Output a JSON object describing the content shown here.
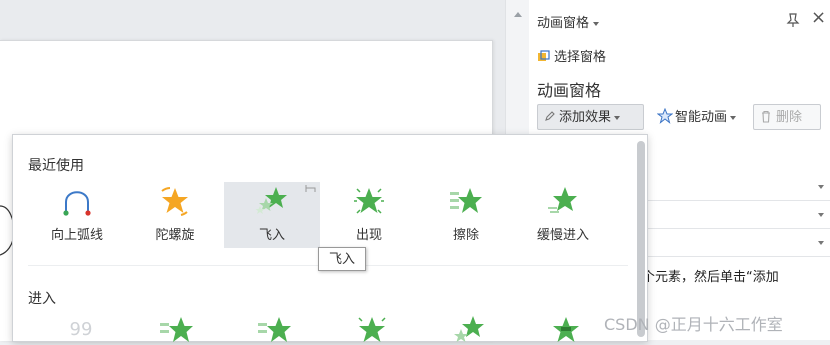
{
  "pane": {
    "title": "动画窗格",
    "select_pane": "选择窗格",
    "section_title": "动画窗格",
    "add_effect": "添加效果",
    "smart_animation": "智能动画",
    "delete": "删除",
    "hint": "某个元素，然后单击“添加\n画。"
  },
  "gallery": {
    "recent_title": "最近使用",
    "enter_title": "进入",
    "recent_items": [
      {
        "label": "向上弧线",
        "icon": "arc-up-icon"
      },
      {
        "label": "陀螺旋",
        "icon": "spin-star-icon"
      },
      {
        "label": "飞入",
        "icon": "fly-in-star-icon",
        "selected": true
      },
      {
        "label": "出现",
        "icon": "appear-star-icon"
      },
      {
        "label": "擦除",
        "icon": "wipe-star-icon"
      },
      {
        "label": "缓慢进入",
        "icon": "slow-in-star-icon"
      }
    ],
    "tooltip": "飞入"
  },
  "watermark": "CSDN @正月十六工作室",
  "colors": {
    "star_green": "#4caf50",
    "star_orange": "#f5a623",
    "arc_blue": "#3c79c8"
  }
}
